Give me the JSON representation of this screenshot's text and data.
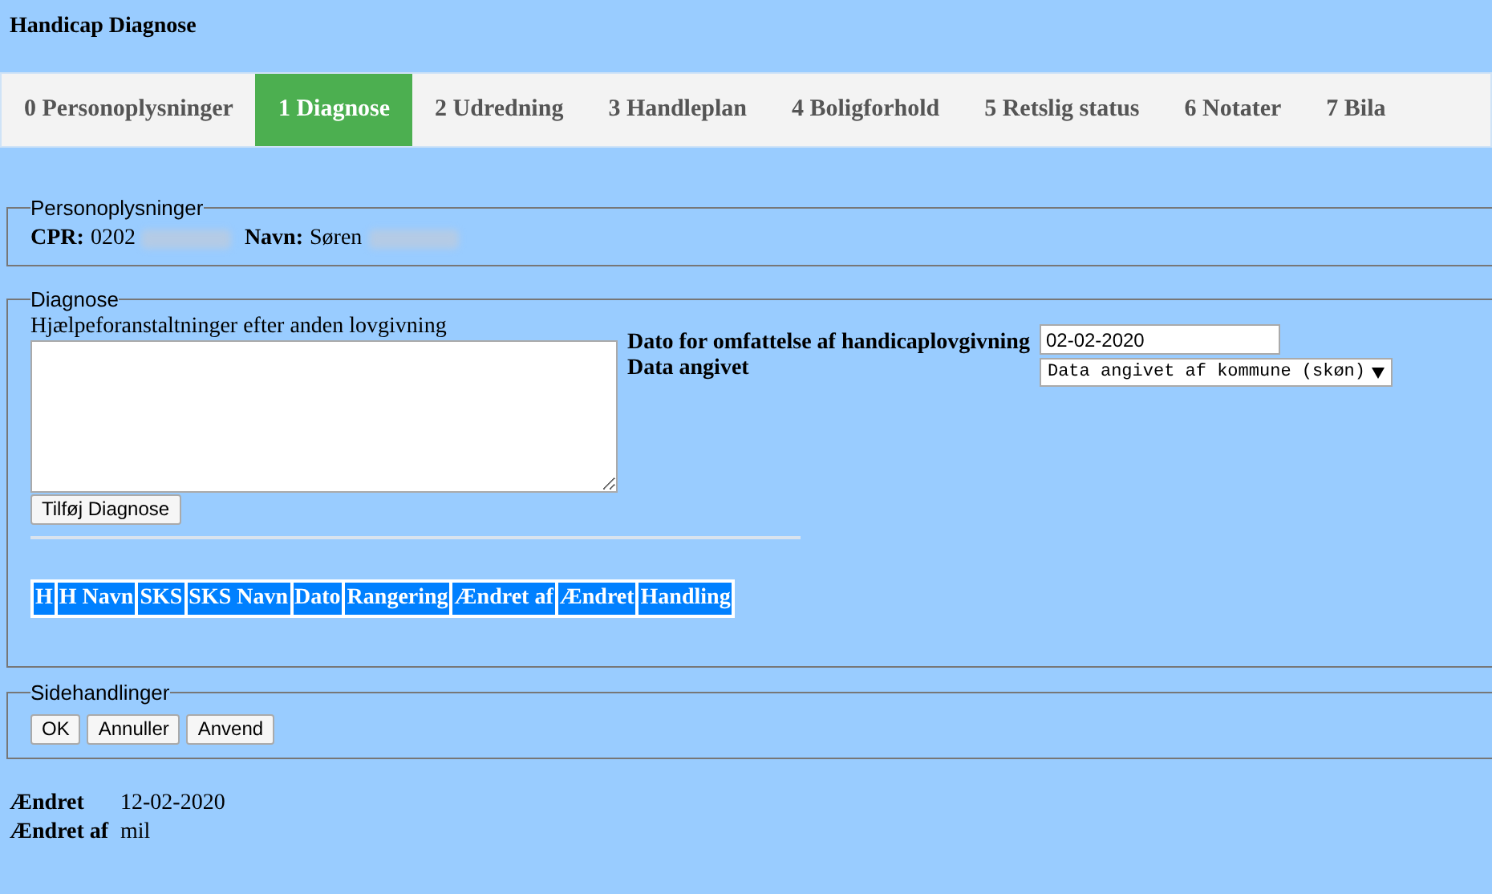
{
  "window": {
    "title": "Handicap Diagnose"
  },
  "tabs": [
    {
      "label": "0 Personoplysninger",
      "selected": false
    },
    {
      "label": "1 Diagnose",
      "selected": true
    },
    {
      "label": "2 Udredning",
      "selected": false
    },
    {
      "label": "3 Handleplan",
      "selected": false
    },
    {
      "label": "4 Boligforhold",
      "selected": false
    },
    {
      "label": "5 Retslig status",
      "selected": false
    },
    {
      "label": "6 Notater",
      "selected": false
    },
    {
      "label": "7 Bila",
      "selected": false
    }
  ],
  "personal": {
    "legend": "Personoplysninger",
    "fields": [
      {
        "label": "CPR:",
        "value": "0202",
        "redacted": true
      },
      {
        "label": "Navn:",
        "value": "Søren",
        "redacted": true
      }
    ]
  },
  "diagnose": {
    "legend": "Diagnose",
    "textarea_label": "Hjælpeforanstaltninger efter anden lovgivning",
    "add_button": "Tilføj Diagnose",
    "date_label": "Dato for omfattelse af handicaplovgivning",
    "date_value": "02-02-2020",
    "source_label": "Data angivet",
    "source_value": "Data angivet af kommune (skøn)",
    "table": {
      "columns": [
        "H",
        "H Navn",
        "SKS",
        "SKS Navn",
        "Dato",
        "Rangering",
        "Ændret af",
        "Ændret",
        "Handling"
      ]
    }
  },
  "page_actions": {
    "legend": "Sidehandlinger",
    "buttons": [
      "OK",
      "Annuller",
      "Anvend"
    ]
  },
  "footer": [
    {
      "label": "Ændret",
      "value": "12-02-2020"
    },
    {
      "label": "Ændret af",
      "value": "mil"
    }
  ]
}
